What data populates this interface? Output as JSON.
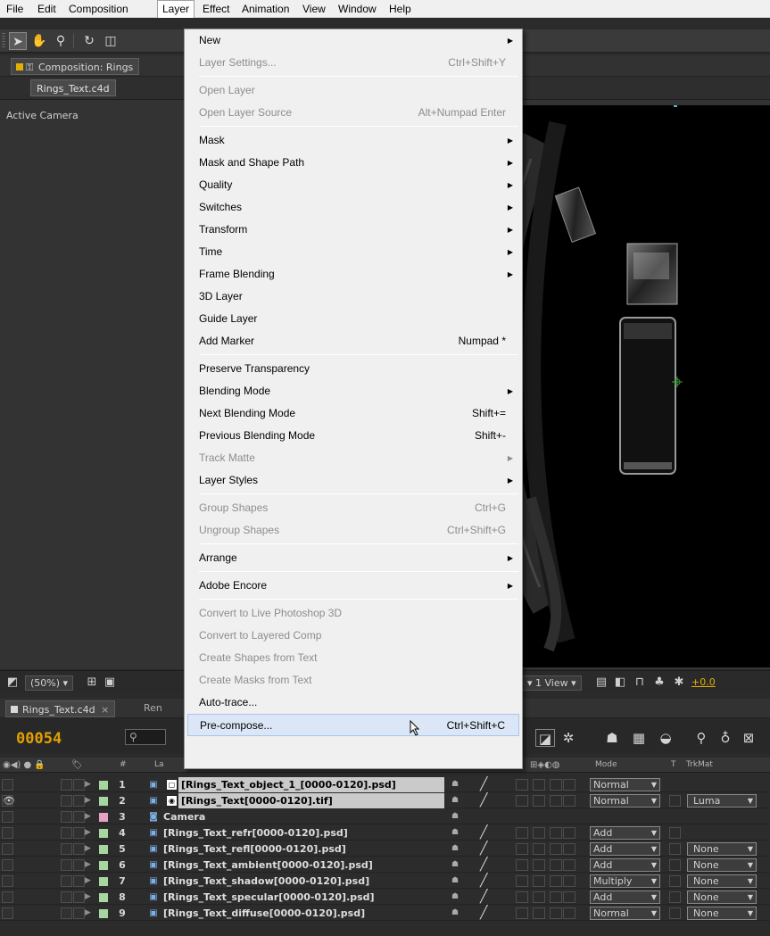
{
  "menubar": {
    "items": [
      "File",
      "Edit",
      "Composition",
      "Layer",
      "Effect",
      "Animation",
      "View",
      "Window",
      "Help"
    ]
  },
  "composition_panel": {
    "tab_label": "Composition: Rings",
    "breadcrumb": "Rings_Text.c4d",
    "view_label": "Active Camera",
    "zoom": "(50%)",
    "view_layout": "1 View",
    "exposure_value": "+0.0"
  },
  "timeline": {
    "tab_label": "Rings_Text.c4d",
    "tab_close": "×",
    "tab2_label": "Ren",
    "timecode": "00054",
    "search_icon_glyph": "⚲",
    "columns": {
      "num": "#",
      "layer": "La",
      "mode": "Mode",
      "t": "T",
      "trkmat": "TrkMat"
    },
    "layers": [
      {
        "num": "1",
        "name": "[Rings_Text_object_1_[0000-0120].psd]",
        "mode": "Normal",
        "trkmat": "",
        "label_color": "#a7d7a0",
        "selected": true,
        "icon": "footage"
      },
      {
        "num": "2",
        "name": "[Rings_Text[0000-0120].tif]",
        "mode": "Normal",
        "trkmat": "Luma",
        "label_color": "#a7d7a0",
        "selected": true,
        "icon": "footage"
      },
      {
        "num": "3",
        "name": "Camera",
        "mode": "",
        "trkmat": "",
        "label_color": "#e6a2c0",
        "selected": false,
        "icon": "camera"
      },
      {
        "num": "4",
        "name": "[Rings_Text_refr[0000-0120].psd]",
        "mode": "Add",
        "trkmat": "",
        "label_color": "#a7d7a0",
        "selected": false,
        "icon": "footage"
      },
      {
        "num": "5",
        "name": "[Rings_Text_refl[0000-0120].psd]",
        "mode": "Add",
        "trkmat": "None",
        "label_color": "#a7d7a0",
        "selected": false,
        "icon": "footage"
      },
      {
        "num": "6",
        "name": "[Rings_Text_ambient[0000-0120].psd]",
        "mode": "Add",
        "trkmat": "None",
        "label_color": "#a7d7a0",
        "selected": false,
        "icon": "footage"
      },
      {
        "num": "7",
        "name": "[Rings_Text_shadow[0000-0120].psd]",
        "mode": "Multiply",
        "trkmat": "None",
        "label_color": "#a7d7a0",
        "selected": false,
        "icon": "footage"
      },
      {
        "num": "8",
        "name": "[Rings_Text_specular[0000-0120].psd]",
        "mode": "Add",
        "trkmat": "None",
        "label_color": "#a7d7a0",
        "selected": false,
        "icon": "footage"
      },
      {
        "num": "9",
        "name": "[Rings_Text_diffuse[0000-0120].psd]",
        "mode": "Normal",
        "trkmat": "None",
        "label_color": "#a7d7a0",
        "selected": false,
        "icon": "footage"
      }
    ]
  },
  "layer_menu": {
    "items": [
      {
        "label": "New",
        "shortcut": "",
        "submenu": true,
        "disabled": false
      },
      {
        "label": "Layer Settings...",
        "shortcut": "Ctrl+Shift+Y",
        "submenu": false,
        "disabled": true
      },
      {
        "separator": true
      },
      {
        "label": "Open Layer",
        "shortcut": "",
        "submenu": false,
        "disabled": true
      },
      {
        "label": "Open Layer Source",
        "shortcut": "Alt+Numpad Enter",
        "submenu": false,
        "disabled": true
      },
      {
        "separator": true
      },
      {
        "label": "Mask",
        "shortcut": "",
        "submenu": true,
        "disabled": false
      },
      {
        "label": "Mask and Shape Path",
        "shortcut": "",
        "submenu": true,
        "disabled": false
      },
      {
        "label": "Quality",
        "shortcut": "",
        "submenu": true,
        "disabled": false
      },
      {
        "label": "Switches",
        "shortcut": "",
        "submenu": true,
        "disabled": false
      },
      {
        "label": "Transform",
        "shortcut": "",
        "submenu": true,
        "disabled": false
      },
      {
        "label": "Time",
        "shortcut": "",
        "submenu": true,
        "disabled": false
      },
      {
        "label": "Frame Blending",
        "shortcut": "",
        "submenu": true,
        "disabled": false
      },
      {
        "label": "3D Layer",
        "shortcut": "",
        "submenu": false,
        "disabled": false
      },
      {
        "label": "Guide Layer",
        "shortcut": "",
        "submenu": false,
        "disabled": false
      },
      {
        "label": "Add Marker",
        "shortcut": "Numpad *",
        "submenu": false,
        "disabled": false
      },
      {
        "separator": true
      },
      {
        "label": "Preserve Transparency",
        "shortcut": "",
        "submenu": false,
        "disabled": false
      },
      {
        "label": "Blending Mode",
        "shortcut": "",
        "submenu": true,
        "disabled": false
      },
      {
        "label": "Next Blending Mode",
        "shortcut": "Shift+=",
        "submenu": false,
        "disabled": false
      },
      {
        "label": "Previous Blending Mode",
        "shortcut": "Shift+-",
        "submenu": false,
        "disabled": false
      },
      {
        "label": "Track Matte",
        "shortcut": "",
        "submenu": true,
        "disabled": true
      },
      {
        "label": "Layer Styles",
        "shortcut": "",
        "submenu": true,
        "disabled": false
      },
      {
        "separator": true
      },
      {
        "label": "Group Shapes",
        "shortcut": "Ctrl+G",
        "submenu": false,
        "disabled": true
      },
      {
        "label": "Ungroup Shapes",
        "shortcut": "Ctrl+Shift+G",
        "submenu": false,
        "disabled": true
      },
      {
        "separator": true
      },
      {
        "label": "Arrange",
        "shortcut": "",
        "submenu": true,
        "disabled": false
      },
      {
        "separator": true
      },
      {
        "label": "Adobe Encore",
        "shortcut": "",
        "submenu": true,
        "disabled": false
      },
      {
        "separator": true
      },
      {
        "label": "Convert to Live Photoshop 3D",
        "shortcut": "",
        "submenu": false,
        "disabled": true
      },
      {
        "label": "Convert to Layered Comp",
        "shortcut": "",
        "submenu": false,
        "disabled": true
      },
      {
        "label": "Create Shapes from Text",
        "shortcut": "",
        "submenu": false,
        "disabled": true
      },
      {
        "label": "Create Masks from Text",
        "shortcut": "",
        "submenu": false,
        "disabled": true
      },
      {
        "label": "Auto-trace...",
        "shortcut": "",
        "submenu": false,
        "disabled": false
      },
      {
        "label": "Pre-compose...",
        "shortcut": "Ctrl+Shift+C",
        "submenu": false,
        "disabled": false,
        "hover": true
      }
    ]
  },
  "colors": {
    "timecode": "#e2a000",
    "menu_hover": "#dbe7f6",
    "label_green": "#a7d7a0",
    "label_pink": "#e6a2c0",
    "panel_bg": "#2b2b2b"
  }
}
